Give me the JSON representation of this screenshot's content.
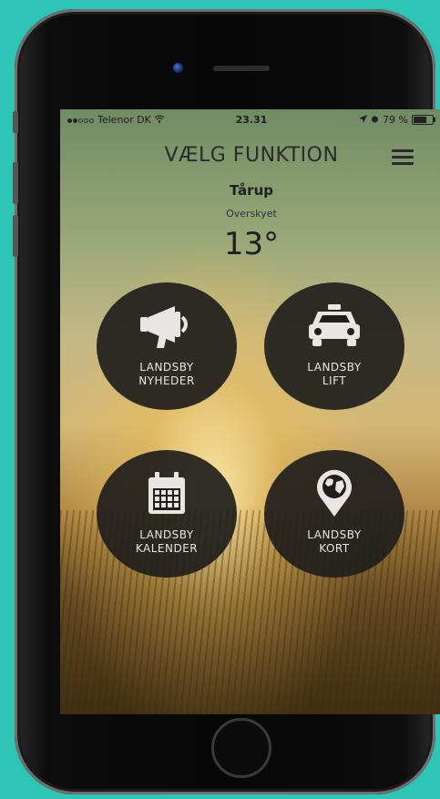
{
  "status_bar": {
    "carrier": "Telenor DK",
    "time": "23.31",
    "battery": "79 %",
    "battery_level": 0.79
  },
  "header": {
    "title": "VÆLG FUNKTION",
    "menu_icon": "hamburger-menu-icon"
  },
  "weather": {
    "location": "Tårup",
    "condition": "Overskyet",
    "temperature": "13°"
  },
  "functions": [
    {
      "line1": "LANDSBY",
      "line2": "NYHEDER",
      "icon": "megaphone-icon"
    },
    {
      "line1": "LANDSBY",
      "line2": "LIFT",
      "icon": "car-icon"
    },
    {
      "line1": "LANDSBY",
      "line2": "KALENDER",
      "icon": "calendar-icon"
    },
    {
      "line1": "LANDSBY",
      "line2": "KORT",
      "icon": "map-pin-icon"
    }
  ],
  "colors": {
    "frame_bg": "#2ec4b6",
    "button_bg": "#201e1c",
    "button_text": "#e8e6e2"
  }
}
